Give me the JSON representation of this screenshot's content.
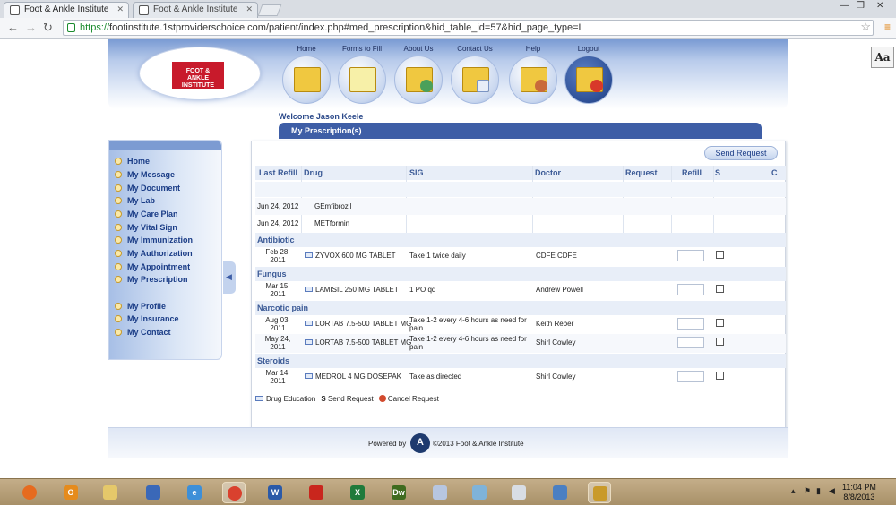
{
  "browser": {
    "tabs": [
      {
        "label": "Foot & Ankle Institute",
        "active": true
      },
      {
        "label": "Foot & Ankle Institute",
        "active": false
      }
    ],
    "url_scheme": "https://",
    "url_rest": "footinstitute.1stproviderschoice.com/patient/index.php#med_prescription&hid_table_id=57&hid_page_type=L",
    "reader_button": "Aa"
  },
  "header": {
    "logo_text": "FOOT & ANKLE INSTITUTE",
    "nav": [
      {
        "label": "Home",
        "icon": "home-folder-icon"
      },
      {
        "label": "Forms to Fill",
        "icon": "forms-icon"
      },
      {
        "label": "About Us",
        "icon": "about-folder-icon"
      },
      {
        "label": "Contact Us",
        "icon": "contact-folder-icon"
      },
      {
        "label": "Help",
        "icon": "help-folder-icon"
      },
      {
        "label": "Logout",
        "icon": "logout-folder-icon"
      }
    ]
  },
  "welcome": "Welcome Jason Keele",
  "page_title": "My Prescription(s)",
  "sidebar": {
    "items": [
      "Home",
      "My Message",
      "My Document",
      "My Lab",
      "My Care Plan",
      "My Vital Sign",
      "My Immunization",
      "My Authorization",
      "My Appointment",
      "My Prescription",
      "My Profile",
      "My Insurance",
      "My Contact"
    ]
  },
  "toolbar": {
    "send_request": "Send Request"
  },
  "table": {
    "headers": [
      "Last Refill",
      "Drug",
      "SIG",
      "Doctor",
      "Request",
      "Refill",
      "S",
      "C"
    ],
    "ungrouped": [
      {
        "date": "Jun 24, 2012",
        "drug": "GEmfibrozil"
      },
      {
        "date": "Jun 24, 2012",
        "drug": "METformin"
      }
    ],
    "groups": [
      {
        "name": "Antibiotic",
        "rows": [
          {
            "date1": "Feb 28,",
            "date2": "2011",
            "drug": "ZYVOX 600 MG TABLET",
            "sig1": "Take 1 twice daily",
            "sig2": "",
            "doctor": "CDFE CDFE"
          }
        ]
      },
      {
        "name": "Fungus",
        "rows": [
          {
            "date1": "Mar 15,",
            "date2": "2011",
            "drug": "LAMISIL 250 MG TABLET",
            "sig1": "1 PO qd",
            "sig2": "",
            "doctor": "Andrew Powell"
          }
        ]
      },
      {
        "name": "Narcotic pain",
        "rows": [
          {
            "date1": "Aug 03,",
            "date2": "2011",
            "drug": "LORTAB 7.5-500 TABLET MG",
            "sig1": "Take 1-2 every 4-6 hours as need for",
            "sig2": "pain",
            "doctor": "Keith Reber"
          },
          {
            "date1": "May 24,",
            "date2": "2011",
            "drug": "LORTAB 7.5-500 TABLET MG",
            "sig1": "Take 1-2 every 4-6 hours as need for",
            "sig2": "pain",
            "doctor": "Shirl Cowley"
          }
        ]
      },
      {
        "name": "Steroids",
        "rows": [
          {
            "date1": "Mar 14,",
            "date2": "2011",
            "drug": "MEDROL 4 MG DOSEPAK",
            "sig1": "Take as directed",
            "sig2": "",
            "doctor": "Shirl Cowley"
          }
        ]
      }
    ]
  },
  "legend": {
    "drug_education": "Drug Education",
    "s_symbol": "S",
    "send_request": "Send Request",
    "cancel_request": "Cancel Request"
  },
  "footer": {
    "powered_by": "Powered by",
    "copyright": "©2013 Foot & Ankle Institute"
  },
  "taskbar": {
    "apps": [
      "firefox-icon",
      "outlook-icon",
      "explorer-icon",
      "network-icon",
      "ie-icon",
      "chrome-icon",
      "word-icon",
      "pdf-icon",
      "excel-icon",
      "dreamweaver-icon",
      "paint-icon",
      "notepad-icon",
      "calculator-icon",
      "remote-icon",
      "archive-icon"
    ],
    "time": "11:04 PM",
    "date": "8/8/2013"
  }
}
